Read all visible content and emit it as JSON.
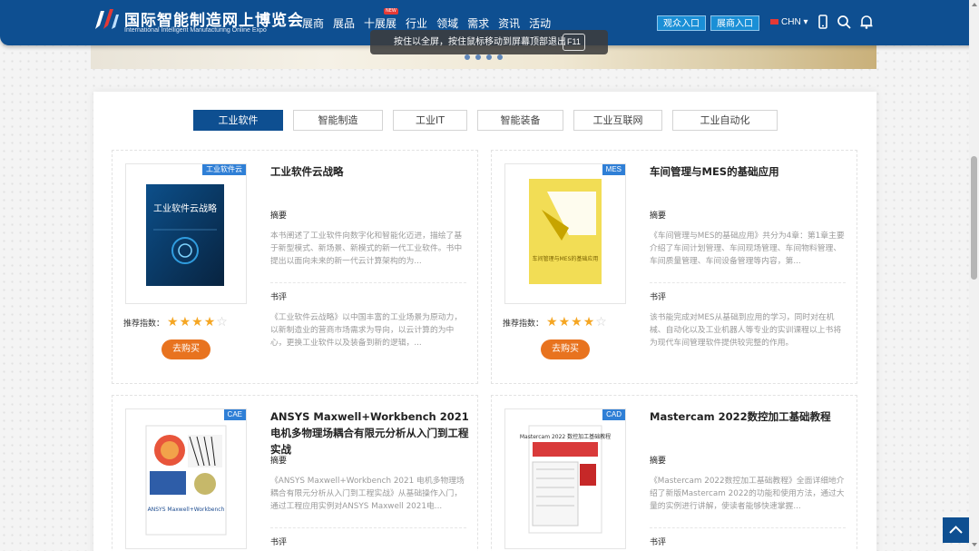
{
  "header": {
    "logo_cn": "国际智能制造网上博览会",
    "logo_en": "International Intelligent Manufacturing Online Expo",
    "nav": [
      {
        "label": "展商",
        "badge": ""
      },
      {
        "label": "展品",
        "badge": ""
      },
      {
        "label": "十展展",
        "badge": "NEW"
      },
      {
        "label": "行业",
        "badge": ""
      },
      {
        "label": "领域",
        "badge": ""
      },
      {
        "label": "需求",
        "badge": ""
      },
      {
        "label": "资讯",
        "badge": ""
      },
      {
        "label": "活动",
        "badge": ""
      }
    ],
    "visitor_btn": "观众入口",
    "exhibitor_btn": "展商入口",
    "language": "CHN",
    "icons": [
      "mobile-icon",
      "search-icon",
      "bell-icon"
    ]
  },
  "fullscreen_tip": {
    "text": "按住以全屏，按住鼠标移动到屏幕顶部退出",
    "key": "F11"
  },
  "tabs": [
    {
      "label": "工业软件",
      "active": true
    },
    {
      "label": "智能制造",
      "active": false
    },
    {
      "label": "工业IT",
      "active": false
    },
    {
      "label": "智能装备",
      "active": false
    },
    {
      "label": "工业互联网",
      "active": false
    },
    {
      "label": "工业自动化",
      "active": false
    }
  ],
  "books": [
    {
      "tag": "工业软件云",
      "title": "工业软件云战略",
      "cover_title": "工业软件云战略",
      "summary_label": "摘要",
      "summary": "本书阐述了工业软件向数字化和智能化迈进，描绘了基于新型模式、新场景、新模式的新一代工业软件。书中提出以面向未来的新一代云计算架构的为...",
      "review_label": "书评",
      "review": "《工业软件云战略》以中国丰富的工业场景为原动力，以新制造业的营商市场需求为导向，以云计算的为中心，更换工业软件以及装备到新的逻辑，...",
      "rec_label": "推荐指数：",
      "rating": 4,
      "buy_label": "去购买"
    },
    {
      "tag": "MES",
      "title": "车间管理与MES的基础应用",
      "cover_title": "车间管理与MES的基础应用",
      "summary_label": "摘要",
      "summary": "《车间管理与MES的基础应用》共分为4章：第1章主要介绍了车间计划管理、车间现场管理、车间物料管理、车间质量管理、车间设备管理等内容，第...",
      "review_label": "书评",
      "review": "该书能完成对MES从基础到应用的学习，同时对在机械、自动化以及工业机器人等专业的实训课程以上书将为现代车间管理软件提供较完整的作用。",
      "rec_label": "推荐指数：",
      "rating": 4,
      "buy_label": "去购买"
    },
    {
      "tag": "CAE",
      "title": "ANSYS Maxwell+Workbench 2021 电机多物理场耦合有限元分析从入门到工程实战",
      "cover_title": "ANSYS Maxwell+Workbench",
      "summary_label": "摘要",
      "summary": "《ANSYS Maxwell+Workbench 2021 电机多物理场耦合有限元分析从入门到工程实战》从基础操作入门，通过工程应用实例对ANSYS Maxwell 2021电...",
      "review_label": "书评"
    },
    {
      "tag": "CAD",
      "title": "Mastercam 2022数控加工基础教程",
      "cover_title": "Mastercam 2022 数控加工基础教程",
      "summary_label": "摘要",
      "summary": "《Mastercam 2022数控加工基础教程》全面详细地介绍了新版Mastercam 2022的功能和使用方法，通过大量的实例进行讲解，使读者能够快速掌握...",
      "review_label": "书评"
    }
  ]
}
